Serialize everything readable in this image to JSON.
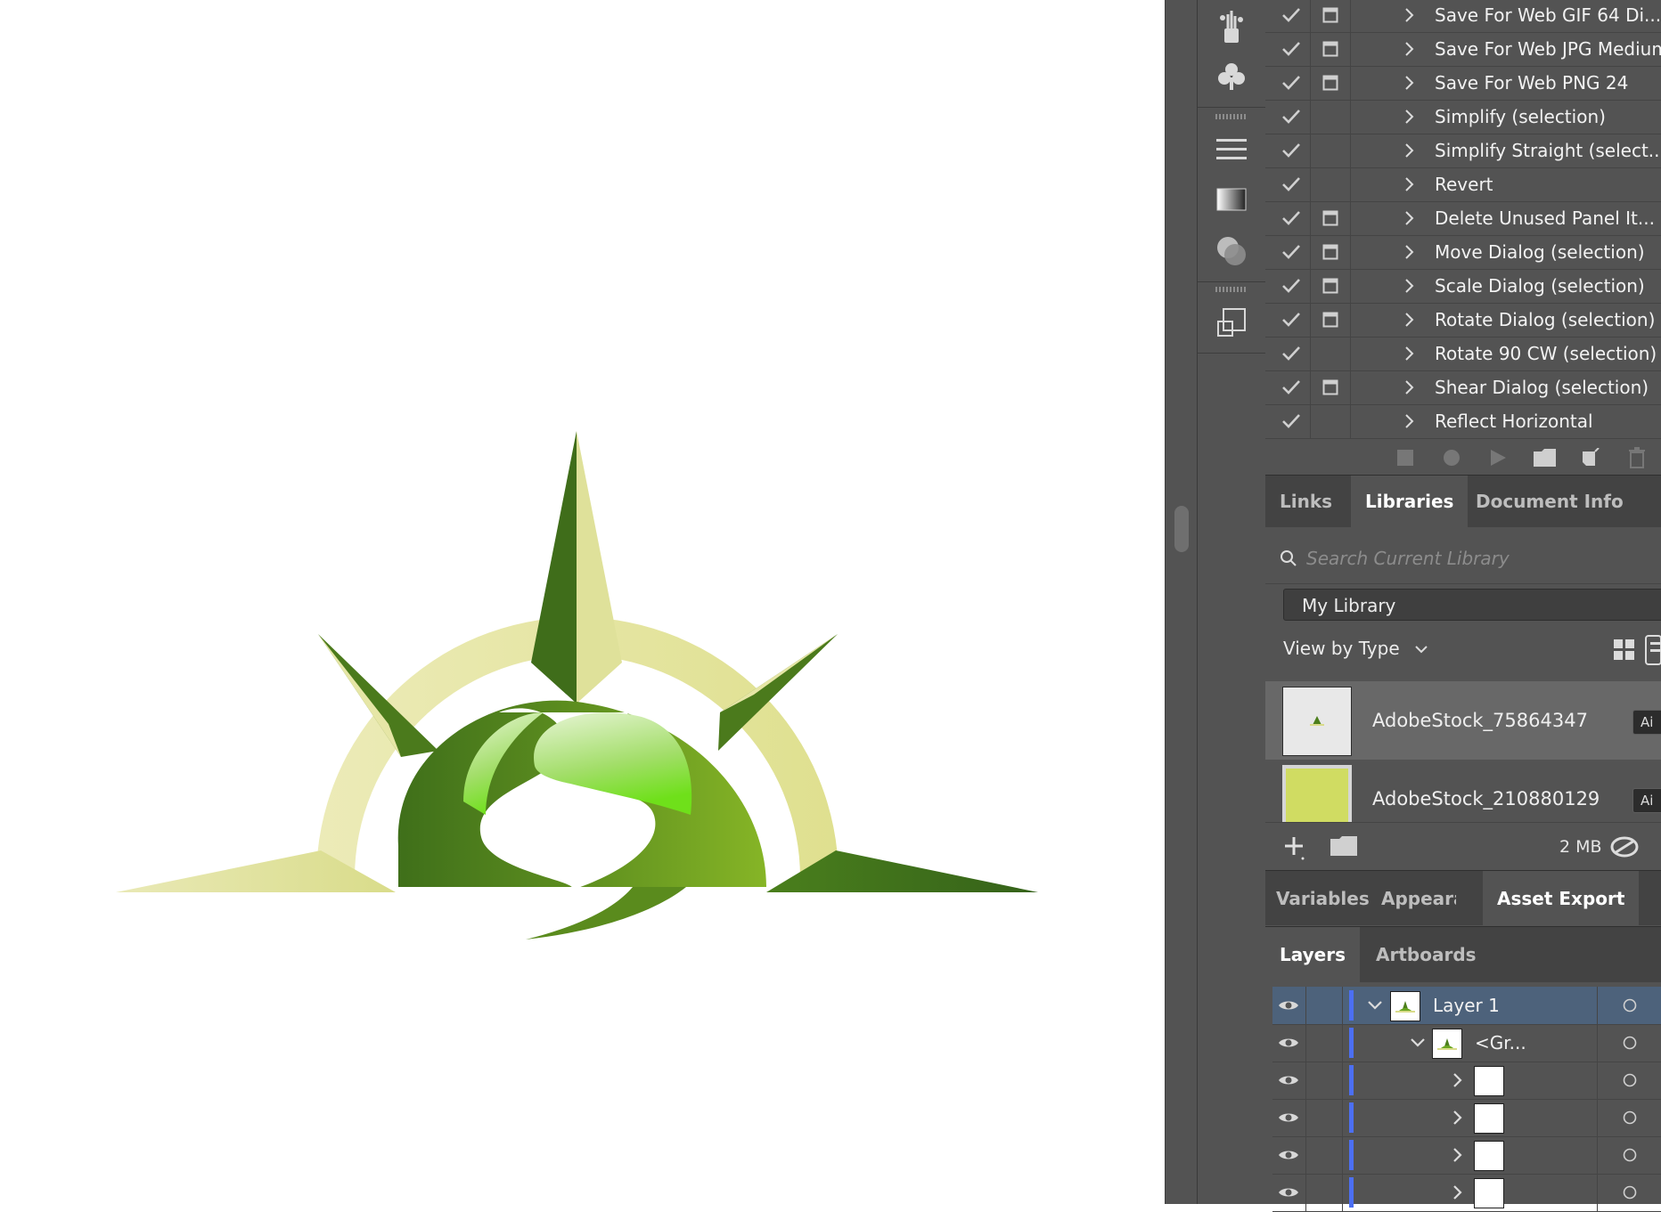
{
  "actions": {
    "items": [
      {
        "label": "Save For Web GIF 64 Di...",
        "has_dialog": true
      },
      {
        "label": "Save For Web JPG Medium",
        "has_dialog": true
      },
      {
        "label": "Save For Web PNG 24",
        "has_dialog": true
      },
      {
        "label": "Simplify (selection)",
        "has_dialog": false
      },
      {
        "label": "Simplify Straight (select...",
        "has_dialog": false
      },
      {
        "label": "Revert",
        "has_dialog": false
      },
      {
        "label": "Delete Unused Panel It...",
        "has_dialog": true
      },
      {
        "label": "Move Dialog (selection)",
        "has_dialog": true
      },
      {
        "label": "Scale Dialog (selection)",
        "has_dialog": true
      },
      {
        "label": "Rotate Dialog (selection)",
        "has_dialog": true
      },
      {
        "label": "Rotate 90 CW (selection)",
        "has_dialog": false
      },
      {
        "label": "Shear Dialog (selection)",
        "has_dialog": true
      },
      {
        "label": "Reflect Horizontal",
        "has_dialog": false
      }
    ]
  },
  "tabs_top": {
    "links": "Links",
    "libraries": "Libraries",
    "document_info": "Document Info"
  },
  "libraries": {
    "search_placeholder": "Search Current Library",
    "library_name": "My Library",
    "view_by": "View by Type",
    "items": [
      {
        "name": "AdobeStock_75864347",
        "badge": "Ai"
      },
      {
        "name": "AdobeStock_210880129",
        "badge": "Ai"
      }
    ],
    "storage": "2 MB"
  },
  "tabs_mid": {
    "variables": "Variables",
    "appearance": "Appearan",
    "asset_export": "Asset Export"
  },
  "tabs_layers": {
    "layers": "Layers",
    "artboards": "Artboards"
  },
  "layers": {
    "rows": [
      {
        "name": "Layer 1",
        "level": 0,
        "expanded": true
      },
      {
        "name": "<Gr...",
        "level": 1,
        "expanded": true
      },
      {
        "name": "",
        "level": 2,
        "expanded": false
      },
      {
        "name": "",
        "level": 2,
        "expanded": false
      },
      {
        "name": "",
        "level": 2,
        "expanded": false
      },
      {
        "name": "",
        "level": 2,
        "expanded": false
      }
    ]
  },
  "colors": {
    "panel": "#535353",
    "selection": "#4d627b",
    "layer_color": "#4c6ff2",
    "logo_dark_green": "#3d6b1a",
    "logo_light_yellow": "#e6e7a4",
    "logo_bright_green": "#77e21c"
  }
}
